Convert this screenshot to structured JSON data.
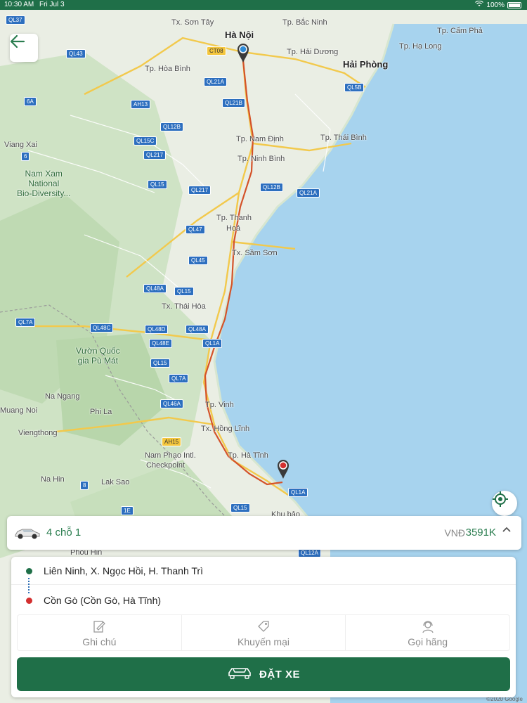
{
  "status_bar": {
    "time": "10:30 AM",
    "date": "Fri Jul 3",
    "battery": "100%"
  },
  "map": {
    "credit": "©2020 Google",
    "cities": [
      {
        "name": "Hà Nội",
        "major": true
      },
      {
        "name": "Hải Phòng",
        "major": true
      }
    ],
    "labels": [
      "Tx. Sơn Tây",
      "Tp. Bắc Ninh",
      "Tp. Cẩm Phả",
      "Tp. Hạ Long",
      "Tp. Hải Dương",
      "Tp. Hòa Bình",
      "Tp. Nam Định",
      "Tp. Thái Bình",
      "Tp. Ninh Bình",
      "Viang Xai",
      "Tp. Thanh",
      "Hoá",
      "Tx. Sầm Sơn",
      "Tx. Thái Hòa",
      "Tp. Vinh",
      "Tx. Hồng Lĩnh",
      "Tp. Hà Tĩnh",
      "Na Ngang",
      "Muang Noi",
      "Phi La",
      "Viengthong",
      "Nam Phao Intl.",
      "Checkpoint",
      "Na Hin",
      "Lak Sao",
      "Khu bảo",
      "Phou Hin"
    ],
    "parks": [
      "Nam Xam\nNational\nBio-Diversity...",
      "Vườn Quốc\ngia Pù Mát"
    ],
    "roads": [
      "QL37",
      "QL43",
      "CT08",
      "QL21A",
      "6A",
      "AH13",
      "QL21B",
      "QL5B",
      "QL12B",
      "QL15C",
      "6",
      "QL217",
      "QL12B",
      "QL15",
      "QL217",
      "QL21A",
      "QL47",
      "QL45",
      "QL48A",
      "QL15",
      "QL7A",
      "QL48C",
      "QL48D",
      "QL48A",
      "QL48E",
      "QL1A",
      "QL15",
      "QL7A",
      "QL46A",
      "AH15",
      "8",
      "1E",
      "QL1A",
      "QL15",
      "QL12A"
    ]
  },
  "vehicle": {
    "name": "4 chỗ 1",
    "currency": "VNĐ",
    "price": "3591K"
  },
  "trip": {
    "origin": "Liên Ninh, X. Ngọc Hồi, H. Thanh Trì",
    "destination": "Cồn Gò (Cồn Gò, Hà Tĩnh)"
  },
  "actions": [
    {
      "label": "Ghi chú",
      "icon": "note-icon"
    },
    {
      "label": "Khuyến mại",
      "icon": "tag-icon"
    },
    {
      "label": "Gọi hãng",
      "icon": "support-agent-icon"
    }
  ],
  "book_button": {
    "label": "ĐẶT XE"
  },
  "colors": {
    "primary": "#1f6f48",
    "accent": "#2a7d4f",
    "destination": "#d32f2f",
    "origin_pin": "#2e8bd6"
  }
}
